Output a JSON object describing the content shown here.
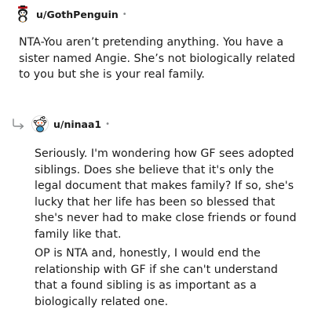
{
  "comments": [
    {
      "username": "u/GothPenguin",
      "separator": "•",
      "avatar_icon": "penguin-avatar-icon",
      "paragraphs": [
        "NTA-You aren’t pretending anything. You have a sister named Angie. She’s not biologically related to you but she is your real family."
      ]
    },
    {
      "username": "u/ninaa1",
      "separator": "•",
      "reply_icon": "reply-arrow-icon",
      "avatar_icon": "snoo-avatar-icon",
      "paragraphs": [
        "Seriously. I'm wondering how GF sees adopted siblings. Does she believe that it's only the legal document that makes family? If so, she's lucky that her life has been so blessed that she's never had to make close friends or found family like that.",
        "OP is NTA and, honestly, I would end the relationship with GF if she can't understand that a found sibling is as important as a biologically related one."
      ]
    }
  ]
}
